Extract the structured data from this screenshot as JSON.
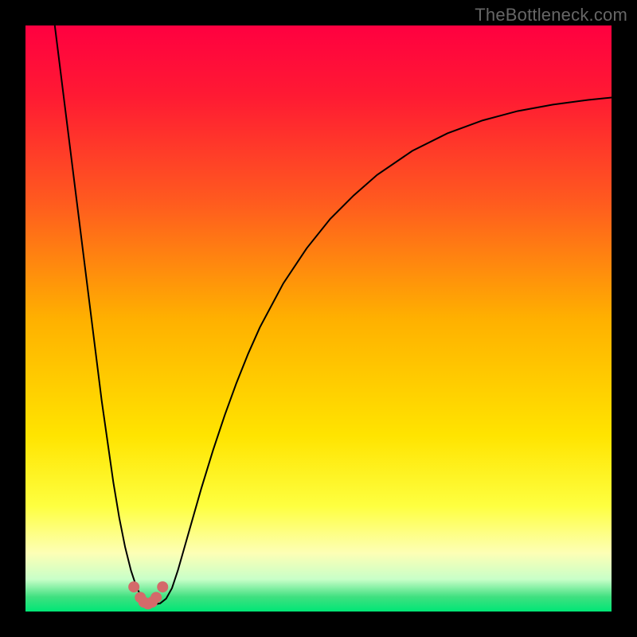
{
  "watermark": "TheBottleneck.com",
  "chart_data": {
    "type": "line",
    "title": "",
    "xlabel": "",
    "ylabel": "",
    "xlim": [
      0,
      100
    ],
    "ylim": [
      0,
      100
    ],
    "grid": false,
    "legend": false,
    "background_gradient": {
      "stops": [
        {
          "offset": 0.0,
          "color": "#ff0040"
        },
        {
          "offset": 0.12,
          "color": "#ff1a33"
        },
        {
          "offset": 0.3,
          "color": "#ff5a1f"
        },
        {
          "offset": 0.5,
          "color": "#ffb000"
        },
        {
          "offset": 0.7,
          "color": "#ffe400"
        },
        {
          "offset": 0.82,
          "color": "#feff40"
        },
        {
          "offset": 0.9,
          "color": "#fdffb5"
        },
        {
          "offset": 0.945,
          "color": "#c8ffc8"
        },
        {
          "offset": 0.975,
          "color": "#40e080"
        },
        {
          "offset": 1.0,
          "color": "#00e676"
        }
      ]
    },
    "series": [
      {
        "name": "bottleneck-curve",
        "color": "#000000",
        "stroke_width": 2,
        "x": [
          5,
          6,
          7,
          8,
          9,
          10,
          11,
          12,
          13,
          14,
          15,
          16,
          17,
          18,
          19,
          20,
          21,
          22,
          23,
          24,
          25,
          26,
          27,
          28,
          30,
          32,
          34,
          36,
          38,
          40,
          44,
          48,
          52,
          56,
          60,
          66,
          72,
          78,
          84,
          90,
          96,
          100
        ],
        "y": [
          100,
          92,
          84,
          76,
          68,
          60,
          52,
          44,
          36,
          29,
          22,
          16,
          11,
          7,
          4,
          2.2,
          1.4,
          1.2,
          1.4,
          2.2,
          4,
          7,
          10.5,
          14,
          21,
          27.5,
          33.5,
          39,
          44,
          48.5,
          56,
          62,
          67,
          71,
          74.5,
          78.6,
          81.6,
          83.8,
          85.4,
          86.5,
          87.3,
          87.7
        ]
      },
      {
        "name": "marker-dots",
        "type": "scatter",
        "color": "#d46a6a",
        "radius": 7,
        "points": [
          {
            "x": 18.5,
            "y": 4.2
          },
          {
            "x": 19.6,
            "y": 2.4
          },
          {
            "x": 20.2,
            "y": 1.6
          },
          {
            "x": 20.9,
            "y": 1.3
          },
          {
            "x": 21.6,
            "y": 1.6
          },
          {
            "x": 22.3,
            "y": 2.4
          },
          {
            "x": 23.4,
            "y": 4.2
          }
        ]
      }
    ]
  }
}
